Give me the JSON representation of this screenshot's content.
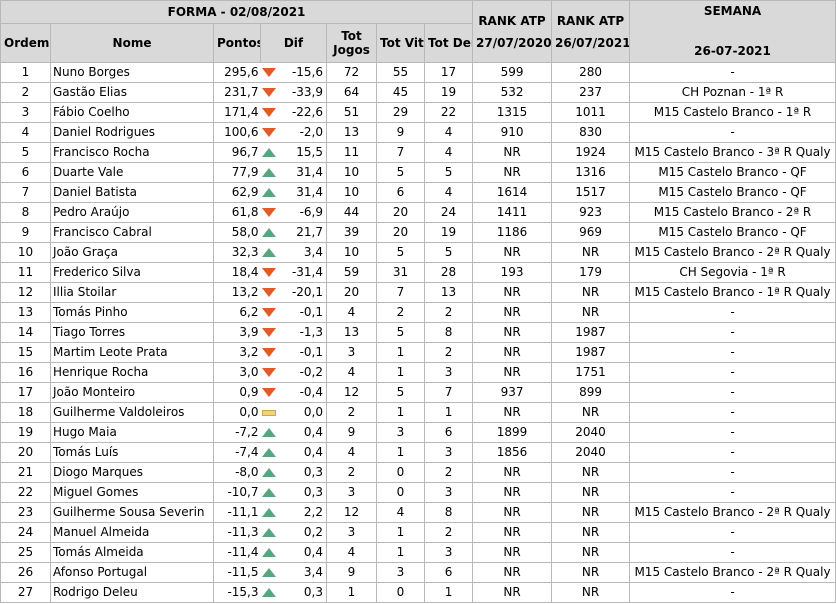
{
  "title": "FORMA - 02/08/2021",
  "headers": {
    "ordem": "Ordem",
    "nome": "Nome",
    "pontos": "Pontos",
    "dif": "Dif",
    "tot_jogos_1": "Tot",
    "tot_jogos_2": "Jogos",
    "tot_vit": "Tot Vit",
    "tot_der": "Tot Der",
    "rank1_a": "RANK ATP",
    "rank1_b": "27/07/2020",
    "rank2_a": "RANK ATP",
    "rank2_b": "26/07/2021",
    "semana_a": "SEMANA",
    "semana_b": "26-07-2021"
  },
  "rows": [
    {
      "ordem": "1",
      "nome": "Nuno Borges",
      "pontos": "295,6",
      "trend": "down",
      "dif": "-15,6",
      "jogos": "72",
      "vit": "55",
      "der": "17",
      "rank1": "599",
      "rank2": "280",
      "semana": "-"
    },
    {
      "ordem": "2",
      "nome": "Gastão Elias",
      "pontos": "231,7",
      "trend": "down",
      "dif": "-33,9",
      "jogos": "64",
      "vit": "45",
      "der": "19",
      "rank1": "532",
      "rank2": "237",
      "semana": "CH Poznan - 1ª R"
    },
    {
      "ordem": "3",
      "nome": "Fábio Coelho",
      "pontos": "171,4",
      "trend": "down",
      "dif": "-22,6",
      "jogos": "51",
      "vit": "29",
      "der": "22",
      "rank1": "1315",
      "rank2": "1011",
      "semana": "M15 Castelo Branco - 1ª R"
    },
    {
      "ordem": "4",
      "nome": "Daniel Rodrigues",
      "pontos": "100,6",
      "trend": "down",
      "dif": "-2,0",
      "jogos": "13",
      "vit": "9",
      "der": "4",
      "rank1": "910",
      "rank2": "830",
      "semana": "-"
    },
    {
      "ordem": "5",
      "nome": "Francisco Rocha",
      "pontos": "96,7",
      "trend": "up",
      "dif": "15,5",
      "jogos": "11",
      "vit": "7",
      "der": "4",
      "rank1": "NR",
      "rank2": "1924",
      "semana": "M15 Castelo Branco - 3ª R Qualy"
    },
    {
      "ordem": "6",
      "nome": "Duarte Vale",
      "pontos": "77,9",
      "trend": "up",
      "dif": "31,4",
      "jogos": "10",
      "vit": "5",
      "der": "5",
      "rank1": "NR",
      "rank2": "1316",
      "semana": "M15 Castelo Branco - QF"
    },
    {
      "ordem": "7",
      "nome": "Daniel Batista",
      "pontos": "62,9",
      "trend": "up",
      "dif": "31,4",
      "jogos": "10",
      "vit": "6",
      "der": "4",
      "rank1": "1614",
      "rank2": "1517",
      "semana": "M15 Castelo Branco - QF"
    },
    {
      "ordem": "8",
      "nome": "Pedro Araújo",
      "pontos": "61,8",
      "trend": "down",
      "dif": "-6,9",
      "jogos": "44",
      "vit": "20",
      "der": "24",
      "rank1": "1411",
      "rank2": "923",
      "semana": "M15 Castelo Branco - 2ª R"
    },
    {
      "ordem": "9",
      "nome": "Francisco Cabral",
      "pontos": "58,0",
      "trend": "up",
      "dif": "21,7",
      "jogos": "39",
      "vit": "20",
      "der": "19",
      "rank1": "1186",
      "rank2": "969",
      "semana": "M15 Castelo Branco - QF"
    },
    {
      "ordem": "10",
      "nome": "João Graça",
      "pontos": "32,3",
      "trend": "up",
      "dif": "3,4",
      "jogos": "10",
      "vit": "5",
      "der": "5",
      "rank1": "NR",
      "rank2": "NR",
      "semana": "M15 Castelo Branco - 2ª R Qualy"
    },
    {
      "ordem": "11",
      "nome": "Frederico Silva",
      "pontos": "18,4",
      "trend": "down",
      "dif": "-31,4",
      "jogos": "59",
      "vit": "31",
      "der": "28",
      "rank1": "193",
      "rank2": "179",
      "semana": "CH Segovia - 1ª R"
    },
    {
      "ordem": "12",
      "nome": "Illia Stoilar",
      "pontos": "13,2",
      "trend": "down",
      "dif": "-20,1",
      "jogos": "20",
      "vit": "7",
      "der": "13",
      "rank1": "NR",
      "rank2": "NR",
      "semana": "M15 Castelo Branco - 1ª R Qualy"
    },
    {
      "ordem": "13",
      "nome": "Tomás Pinho",
      "pontos": "6,2",
      "trend": "down",
      "dif": "-0,1",
      "jogos": "4",
      "vit": "2",
      "der": "2",
      "rank1": "NR",
      "rank2": "NR",
      "semana": "-"
    },
    {
      "ordem": "14",
      "nome": "Tiago Torres",
      "pontos": "3,9",
      "trend": "down",
      "dif": "-1,3",
      "jogos": "13",
      "vit": "5",
      "der": "8",
      "rank1": "NR",
      "rank2": "1987",
      "semana": "-"
    },
    {
      "ordem": "15",
      "nome": "Martim Leote Prata",
      "pontos": "3,2",
      "trend": "down",
      "dif": "-0,1",
      "jogos": "3",
      "vit": "1",
      "der": "2",
      "rank1": "NR",
      "rank2": "1987",
      "semana": "-"
    },
    {
      "ordem": "16",
      "nome": "Henrique Rocha",
      "pontos": "3,0",
      "trend": "down",
      "dif": "-0,2",
      "jogos": "4",
      "vit": "1",
      "der": "3",
      "rank1": "NR",
      "rank2": "1751",
      "semana": "-"
    },
    {
      "ordem": "17",
      "nome": "João Monteiro",
      "pontos": "0,9",
      "trend": "down",
      "dif": "-0,4",
      "jogos": "12",
      "vit": "5",
      "der": "7",
      "rank1": "937",
      "rank2": "899",
      "semana": "-"
    },
    {
      "ordem": "18",
      "nome": "Guilherme Valdoleiros",
      "pontos": "0,0",
      "trend": "eq",
      "dif": "0,0",
      "jogos": "2",
      "vit": "1",
      "der": "1",
      "rank1": "NR",
      "rank2": "NR",
      "semana": "-"
    },
    {
      "ordem": "19",
      "nome": "Hugo Maia",
      "pontos": "-7,2",
      "trend": "up",
      "dif": "0,4",
      "jogos": "9",
      "vit": "3",
      "der": "6",
      "rank1": "1899",
      "rank2": "2040",
      "semana": "-"
    },
    {
      "ordem": "20",
      "nome": "Tomás Luís",
      "pontos": "-7,4",
      "trend": "up",
      "dif": "0,4",
      "jogos": "4",
      "vit": "1",
      "der": "3",
      "rank1": "1856",
      "rank2": "2040",
      "semana": "-"
    },
    {
      "ordem": "21",
      "nome": "Diogo Marques",
      "pontos": "-8,0",
      "trend": "up",
      "dif": "0,3",
      "jogos": "2",
      "vit": "0",
      "der": "2",
      "rank1": "NR",
      "rank2": "NR",
      "semana": "-"
    },
    {
      "ordem": "22",
      "nome": "Miguel Gomes",
      "pontos": "-10,7",
      "trend": "up",
      "dif": "0,3",
      "jogos": "3",
      "vit": "0",
      "der": "3",
      "rank1": "NR",
      "rank2": "NR",
      "semana": "-"
    },
    {
      "ordem": "23",
      "nome": "Guilherme Sousa Severin",
      "pontos": "-11,1",
      "trend": "up",
      "dif": "2,2",
      "jogos": "12",
      "vit": "4",
      "der": "8",
      "rank1": "NR",
      "rank2": "NR",
      "semana": "M15 Castelo Branco - 2ª R Qualy"
    },
    {
      "ordem": "24",
      "nome": "Manuel Almeida",
      "pontos": "-11,3",
      "trend": "up",
      "dif": "0,2",
      "jogos": "3",
      "vit": "1",
      "der": "2",
      "rank1": "NR",
      "rank2": "NR",
      "semana": "-"
    },
    {
      "ordem": "25",
      "nome": "Tomás Almeida",
      "pontos": "-11,4",
      "trend": "up",
      "dif": "0,4",
      "jogos": "4",
      "vit": "1",
      "der": "3",
      "rank1": "NR",
      "rank2": "NR",
      "semana": "-"
    },
    {
      "ordem": "26",
      "nome": "Afonso Portugal",
      "pontos": "-11,5",
      "trend": "up",
      "dif": "3,4",
      "jogos": "9",
      "vit": "3",
      "der": "6",
      "rank1": "NR",
      "rank2": "NR",
      "semana": "M15 Castelo Branco - 2ª R Qualy"
    },
    {
      "ordem": "27",
      "nome": "Rodrigo Deleu",
      "pontos": "-15,3",
      "trend": "up",
      "dif": "0,3",
      "jogos": "1",
      "vit": "0",
      "der": "1",
      "rank1": "NR",
      "rank2": "NR",
      "semana": "-"
    }
  ]
}
